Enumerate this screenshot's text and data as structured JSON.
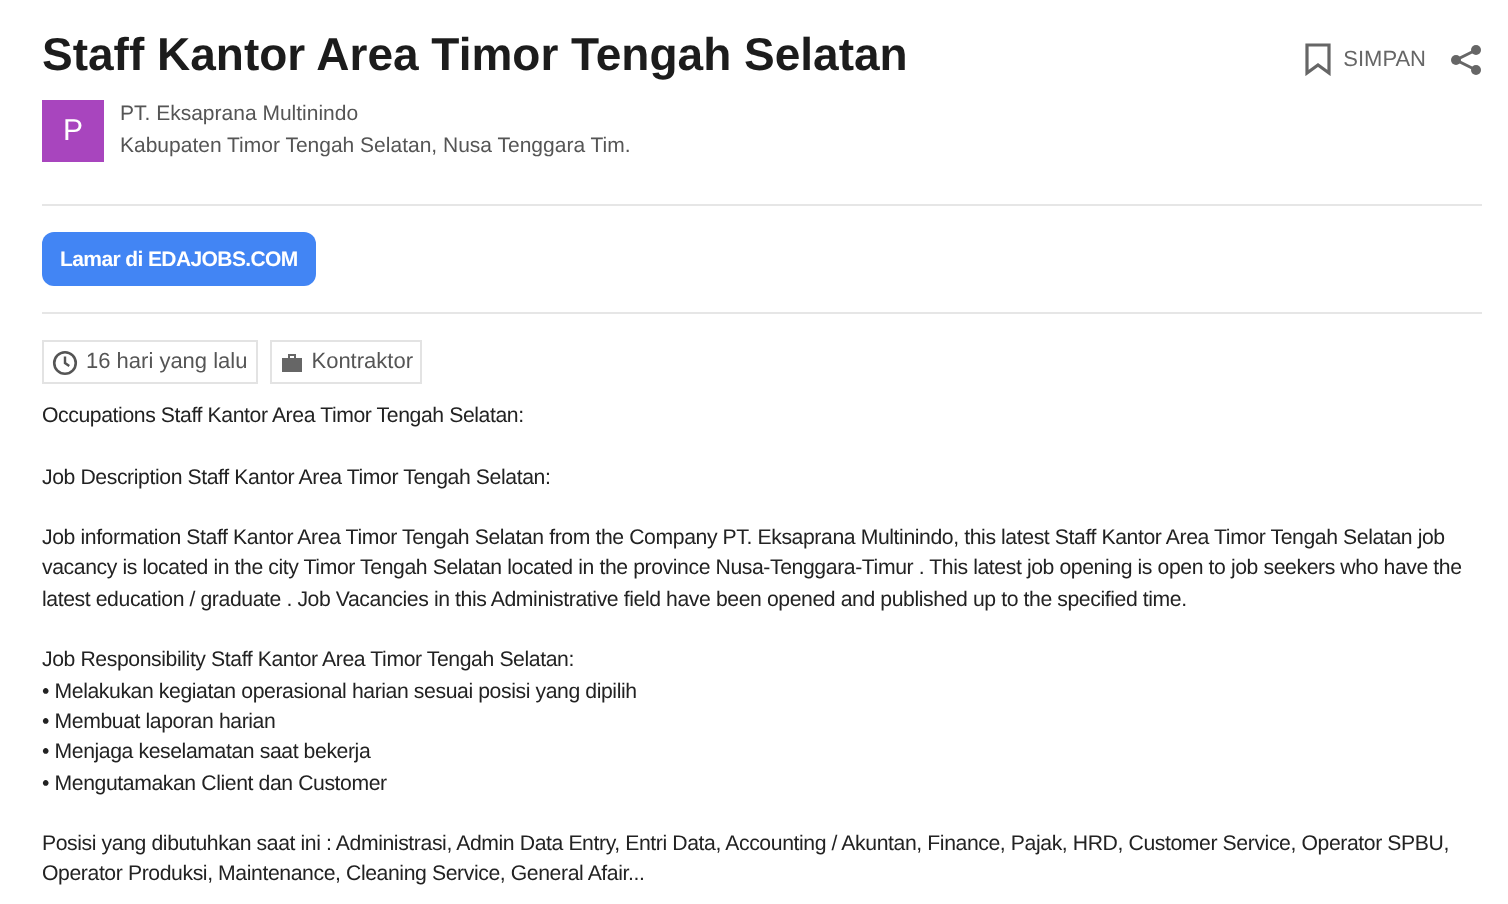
{
  "title": "Staff Kantor Area Timor Tengah Selatan",
  "actions": {
    "save": "SIMPAN"
  },
  "company": {
    "initial": "P",
    "color": "#a845be",
    "name": "PT. Eksaprana Multinindo",
    "location": "Kabupaten Timor Tengah Selatan, Nusa Tenggara Tim."
  },
  "apply_button": "Lamar di EDAJOBS.COM",
  "tags": [
    {
      "kind": "time",
      "label": "16 hari yang lalu"
    },
    {
      "kind": "type",
      "label": "Kontraktor"
    }
  ],
  "description": [
    {
      "kind": "paragraph",
      "text": "Occupations Staff Kantor Area Timor Tengah Selatan:"
    },
    {
      "kind": "paragraph",
      "text": "Job Description Staff Kantor Area Timor Tengah Selatan:"
    },
    {
      "kind": "paragraph",
      "text": "Job information Staff Kantor Area Timor Tengah Selatan from the Company PT. Eksaprana Multinindo, this latest Staff Kantor Area Timor Tengah Selatan job vacancy is located in the city Timor Tengah Selatan located in the province Nusa-Tenggara-Timur . This latest job opening is open to job seekers who have the latest education / graduate . Job Vacancies in this Administrative field have been opened and published up to the specified time."
    },
    {
      "kind": "list",
      "heading": "Job Responsibility Staff Kantor Area Timor Tengah Selatan:",
      "items": [
        "• Melakukan kegiatan operasional harian sesuai posisi yang dipilih",
        "• Membuat laporan harian",
        "• Menjaga keselamatan saat bekerja",
        "• Mengutamakan Client dan Customer"
      ]
    },
    {
      "kind": "paragraph",
      "text": "Posisi yang dibutuhkan saat ini : Administrasi, Admin Data Entry, Entri Data, Accounting / Akuntan, Finance, Pajak, HRD, Customer Service, Operator SPBU, Operator Produksi, Maintenance, Cleaning Service, General Afair..."
    }
  ]
}
